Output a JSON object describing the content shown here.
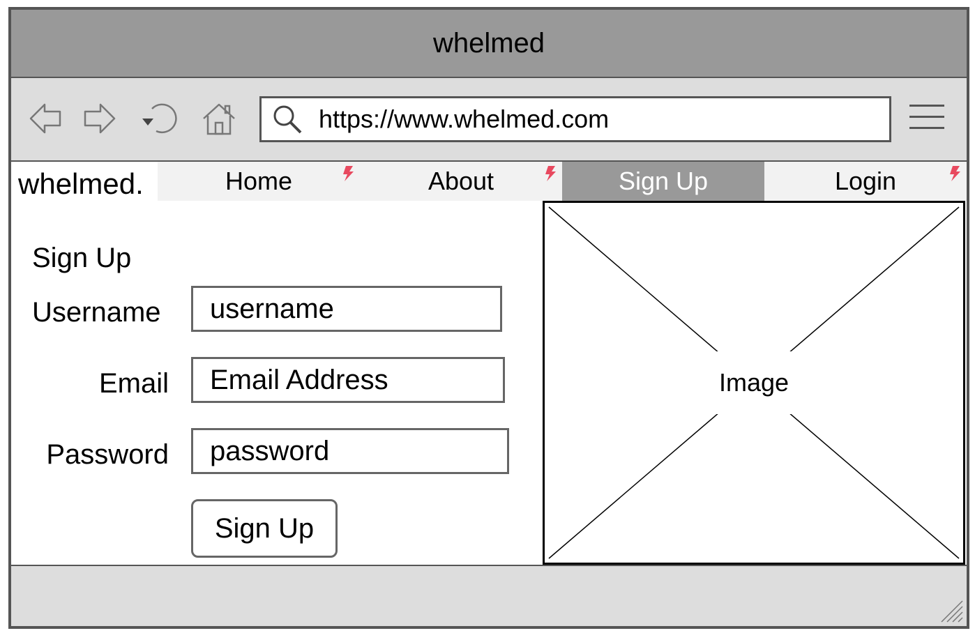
{
  "window": {
    "title": "whelmed"
  },
  "toolbar": {
    "url": "https://www.whelmed.com",
    "icons": [
      "back-icon",
      "forward-icon",
      "reload-icon",
      "home-icon",
      "search-icon",
      "hamburger-menu-icon"
    ]
  },
  "site": {
    "logo": "whelmed.",
    "nav": [
      {
        "label": "Home",
        "active": false,
        "link_indicator": true
      },
      {
        "label": "About",
        "active": false,
        "link_indicator": true
      },
      {
        "label": "Sign Up",
        "active": true,
        "link_indicator": false
      },
      {
        "label": "Login",
        "active": false,
        "link_indicator": true
      }
    ]
  },
  "form": {
    "title": "Sign Up",
    "username_label": "Username",
    "username_value": "username",
    "email_label": "Email",
    "email_value": "Email Address",
    "password_label": "Password",
    "password_value": "password",
    "submit_label": "Sign Up"
  },
  "image": {
    "label": "Image"
  },
  "colors": {
    "titlebar": "#999999",
    "toolbar": "#dddddd",
    "nav_active": "#999999",
    "nav_background": "#f2f2f2",
    "link_indicator": "#e8495f",
    "border": "#555555"
  }
}
